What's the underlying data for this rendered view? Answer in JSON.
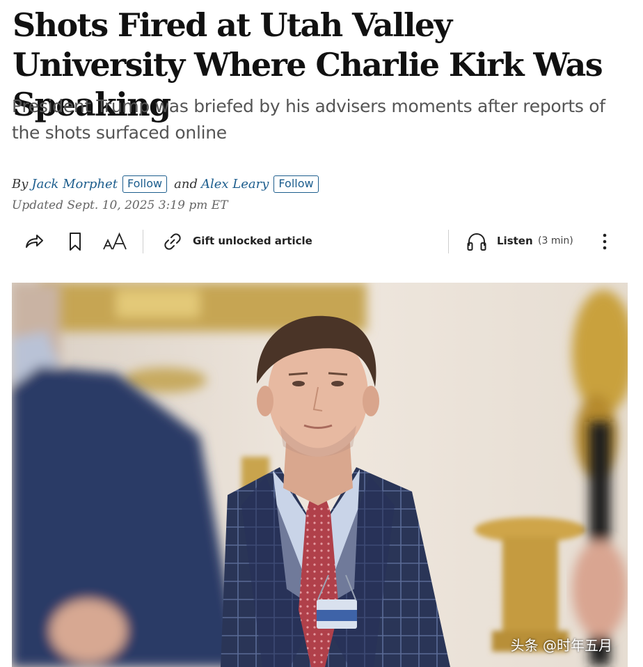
{
  "article": {
    "headline": "Shots Fired at Utah Valley University Where Charlie Kirk Was Speaking",
    "dek": "President Trump was briefed by his advisers moments after reports of the shots surfaced online",
    "byline": {
      "by": "By",
      "author1": "Jack Morphet",
      "follow1": "Follow",
      "and": "and",
      "author2": "Alex Leary",
      "follow2": "Follow"
    },
    "updated": "Updated Sept. 10, 2025 3:19 pm ET"
  },
  "toolbar": {
    "gift_label": "Gift unlocked article",
    "listen_label": "Listen",
    "listen_duration": "(3 min)"
  },
  "watermark": "头条 @时年五月",
  "colors": {
    "link": "#1c5d8d",
    "suit": "#2a3557",
    "wall": "#efe6dc",
    "gold": "#c9a13e"
  }
}
